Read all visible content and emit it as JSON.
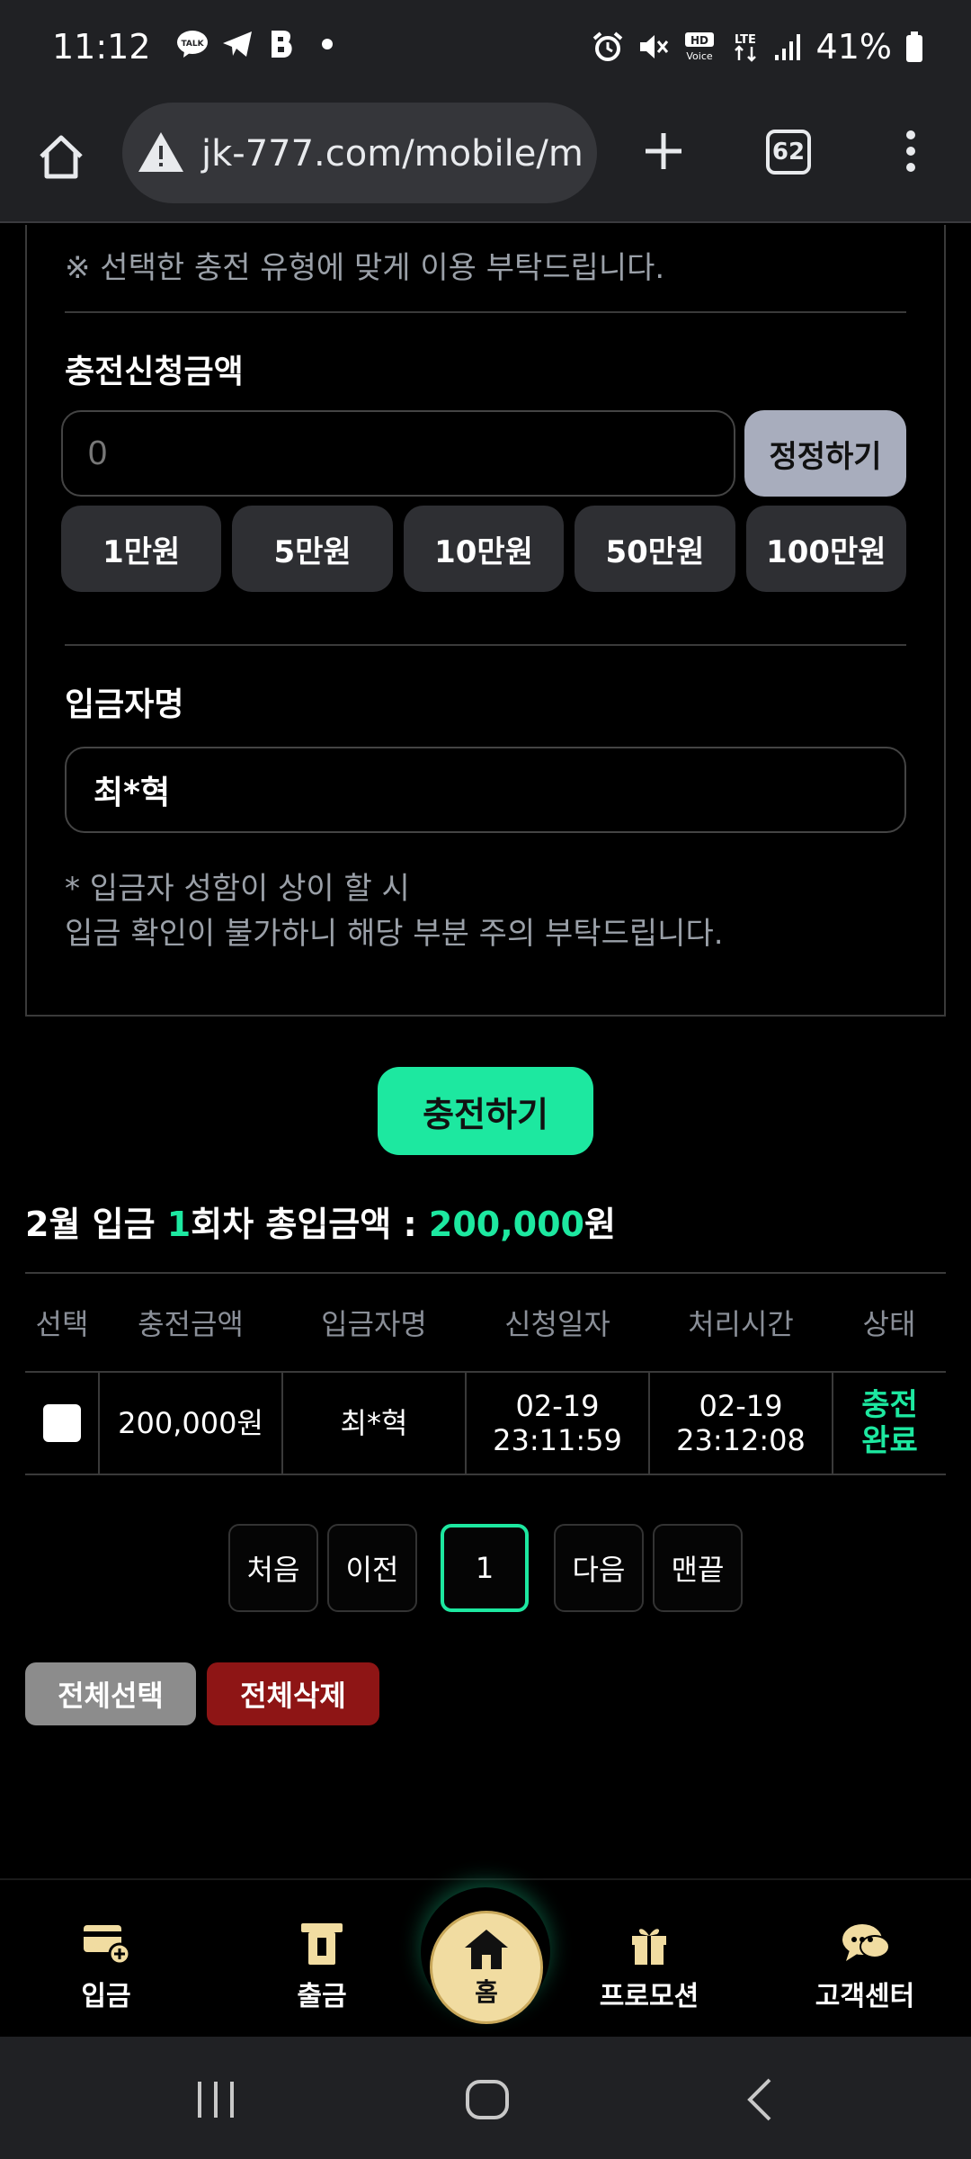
{
  "status_bar": {
    "time": "11:12",
    "battery": "41%",
    "left_icons": [
      "kakaotalk-icon",
      "telegram-icon",
      "b-app-icon",
      "dot-icon"
    ],
    "right_icons": [
      "alarm-icon",
      "mute-icon",
      "hd-voice-icon",
      "lte-icon",
      "signal-icon",
      "battery-icon"
    ]
  },
  "browser": {
    "url": "jk-777.com/mobile/m",
    "tab_count": "62"
  },
  "form": {
    "notice": "※ 선택한 충전 유형에 맞게 이용 부탁드립니다.",
    "amount_title": "충전신청금액",
    "amount_value": "0",
    "reset_label": "정정하기",
    "quick_amounts": [
      "1만원",
      "5만원",
      "10만원",
      "50만원",
      "100만원"
    ],
    "depositor_title": "입금자명",
    "depositor_value": "최*혁",
    "depositor_notice_1": "* 입금자 성함이 상이 할 시",
    "depositor_notice_2": "입금 확인이 불가하니 해당 부분 주의 부탁드립니다.",
    "submit_label": "충전하기"
  },
  "summary": {
    "prefix": "2월 입금 ",
    "count": "1",
    "middle": "회차 총입금액 : ",
    "total": "200,000",
    "suffix": "원"
  },
  "table": {
    "headers": [
      "선택",
      "충전금액",
      "입금자명",
      "신청일자",
      "처리시간",
      "상태"
    ],
    "rows": [
      {
        "amount": "200,000원",
        "depositor": "최*혁",
        "request_date": "02-19",
        "request_time": "23:11:59",
        "process_date": "02-19",
        "process_time": "23:12:08",
        "status_1": "충전",
        "status_2": "완료"
      }
    ]
  },
  "pagination": {
    "first": "처음",
    "prev": "이전",
    "current": "1",
    "next": "다음",
    "last": "맨끝"
  },
  "actions": {
    "select_all": "전체선택",
    "delete_all": "전체삭제"
  },
  "bottom_nav": {
    "deposit": "입금",
    "withdraw": "출금",
    "home": "홈",
    "promotion": "프로모션",
    "support": "고객센터"
  },
  "colors": {
    "accent": "#1de8a0",
    "danger": "#8e1515",
    "home_gold": "#f1dca1"
  }
}
